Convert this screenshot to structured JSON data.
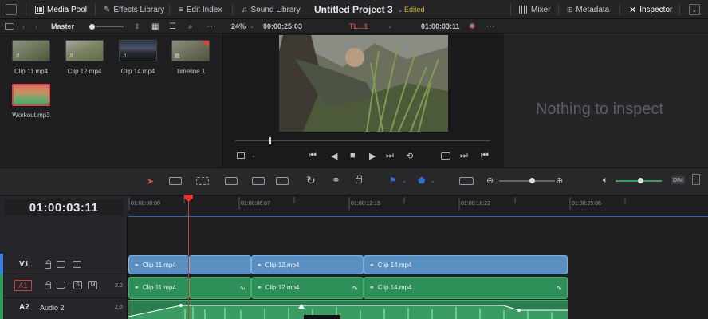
{
  "topbar": {
    "media_pool": "Media Pool",
    "effects_library": "Effects Library",
    "edit_index": "Edit Index",
    "sound_library": "Sound Library",
    "project_title": "Untitled Project 3",
    "edited": "Edited",
    "mixer": "Mixer",
    "metadata": "Metadata",
    "inspector": "Inspector"
  },
  "toolbar2": {
    "bin": "Master",
    "zoom": "24%",
    "source_timecode": "00:00:25:03",
    "timeline_name": "TL...1",
    "record_timecode": "01:00:03:11"
  },
  "media_pool": {
    "clips": [
      {
        "name": "Clip 11.mp4",
        "kind": "video"
      },
      {
        "name": "Clip 12.mp4",
        "kind": "video"
      },
      {
        "name": "Clip 14.mp4",
        "kind": "video"
      },
      {
        "name": "Timeline 1",
        "kind": "timeline"
      },
      {
        "name": "Workout.mp3",
        "kind": "audio",
        "selected": true
      }
    ]
  },
  "inspector": {
    "empty_message": "Nothing to inspect"
  },
  "timeline": {
    "current_timecode": "01:00:03:11",
    "ruler_ticks": [
      "01:00:00:00",
      "01:00:06:07",
      "01:00:12:15",
      "01:00:18:22",
      "01:00:25:06"
    ],
    "tracks": [
      {
        "id": "V1",
        "type": "video",
        "clips": [
          "Clip 11.mp4",
          "Clip 12.mp4",
          "Clip 14.mp4"
        ]
      },
      {
        "id": "A1",
        "type": "audio",
        "channels": "2.0",
        "clips": [
          "Clip 11.mp4",
          "Clip 12.mp4",
          "Clip 14.mp4"
        ]
      },
      {
        "id": "A2",
        "name": "Audio 2",
        "type": "audio",
        "channels": "2.0"
      }
    ],
    "track_controls": {
      "solo": "S",
      "mute": "M",
      "dim": "DIM"
    }
  },
  "colors": {
    "accent_edited": "#d4b43a",
    "video_clip": "#5a8fc2",
    "audio_clip": "#2f8f59",
    "playhead": "#e0342c",
    "timeline_flag": "#2e6fd6"
  }
}
